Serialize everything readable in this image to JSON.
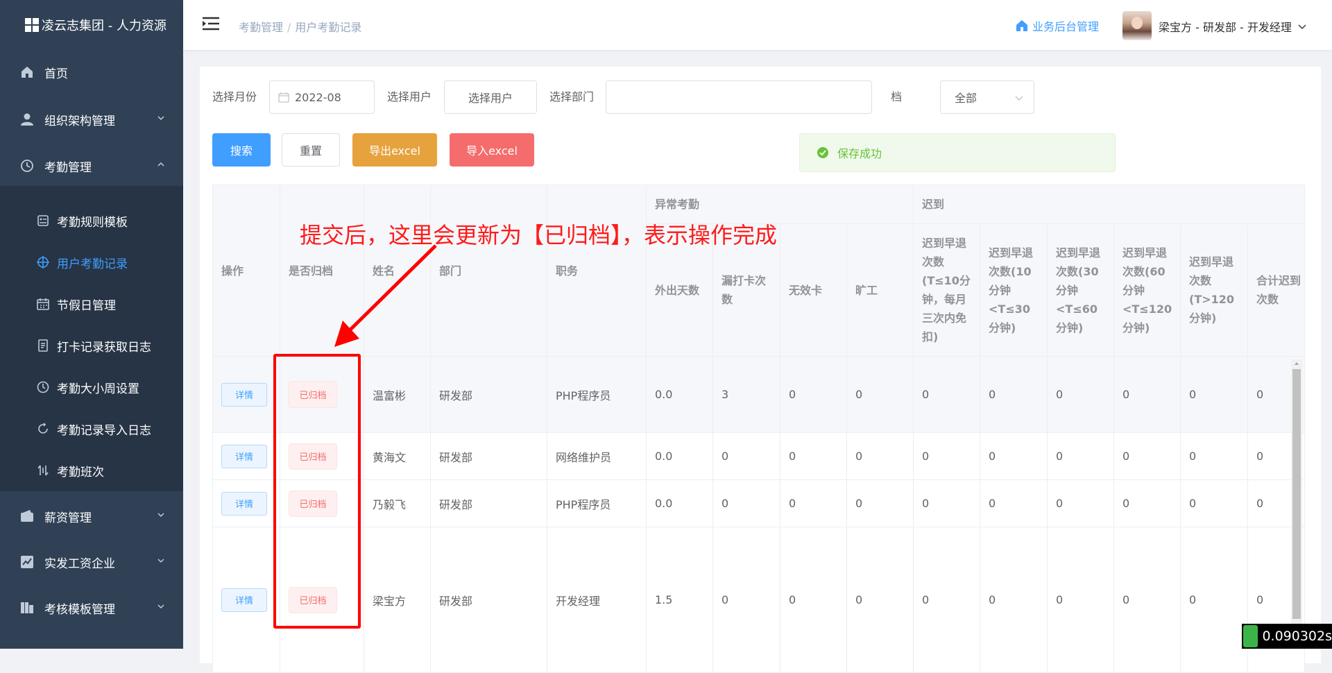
{
  "sidebar": {
    "brand": "凌云志集团 - 人力资源",
    "menu": [
      {
        "label": "首页",
        "icon": "home-icon"
      },
      {
        "label": "组织架构管理",
        "icon": "user-icon"
      },
      {
        "label": "考勤管理",
        "icon": "clock-icon"
      },
      {
        "label": "薪资管理",
        "icon": "wallet-icon"
      },
      {
        "label": "实发工资企业",
        "icon": "chart-icon"
      },
      {
        "label": "考核模板管理",
        "icon": "template-icon"
      }
    ],
    "attendance_sub": [
      {
        "label": "考勤规则模板",
        "icon": "rules-icon"
      },
      {
        "label": "用户考勤记录",
        "icon": "target-icon"
      },
      {
        "label": "节假日管理",
        "icon": "calendar-icon"
      },
      {
        "label": "打卡记录获取日志",
        "icon": "document-icon"
      },
      {
        "label": "考勤大小周设置",
        "icon": "clock-icon"
      },
      {
        "label": "考勤记录导入日志",
        "icon": "refresh-icon"
      },
      {
        "label": "考勤班次",
        "icon": "shift-icon"
      }
    ]
  },
  "navbar": {
    "breadcrumb": [
      "考勤管理",
      "用户考勤记录"
    ],
    "separator": "/",
    "backend_link": "业务后台管理",
    "user": "梁宝方 - 研发部 - 开发经理"
  },
  "filters": {
    "month_label": "选择月份",
    "month_value": "2022-08",
    "user_label": "选择用户",
    "user_placeholder": "选择用户",
    "dept_label": "选择部门",
    "archive_label": "档",
    "archive_value": "全部"
  },
  "buttons": {
    "search": "搜索",
    "reset": "重置",
    "export": "导出excel",
    "import": "导入excel"
  },
  "toast": "保存成功",
  "table": {
    "headers": {
      "op": "操作",
      "archived": "是否归档",
      "name": "姓名",
      "dept": "部门",
      "position": "职务",
      "abnormal_group": "异常考勤",
      "late_group": "迟到",
      "out_days": "外出天数",
      "missed_punch": "漏打卡次数",
      "invalid_card": "无效卡",
      "absent": "旷工",
      "late_10": "迟到早退次数(T≤10分钟，每月三次内免扣)",
      "late_30": "迟到早退次数(10分钟<T≤30分钟)",
      "late_60": "迟到早退次数(30分钟<T≤60分钟)",
      "late_120": "迟到早退次数(60分钟<T≤120分钟)",
      "late_over": "迟到早退次数(T>120分钟)",
      "late_total": "合计迟到次数"
    },
    "detail_label": "详情",
    "rows": [
      {
        "archived": "已归档",
        "name": "温富彬",
        "dept": "研发部",
        "position": "PHP程序员",
        "out_days": "0.0",
        "missed_punch": "3",
        "invalid_card": "0",
        "absent": "0",
        "late_10": "0",
        "late_30": "0",
        "late_60": "0",
        "late_120": "0",
        "late_over": "0",
        "late_total": "0"
      },
      {
        "archived": "已归档",
        "name": "黄海文",
        "dept": "研发部",
        "position": "网络维护员",
        "out_days": "0.0",
        "missed_punch": "0",
        "invalid_card": "0",
        "absent": "0",
        "late_10": "0",
        "late_30": "0",
        "late_60": "0",
        "late_120": "0",
        "late_over": "0",
        "late_total": "0"
      },
      {
        "archived": "已归档",
        "name": "乃毅飞",
        "dept": "研发部",
        "position": "PHP程序员",
        "out_days": "0.0",
        "missed_punch": "0",
        "invalid_card": "0",
        "absent": "0",
        "late_10": "0",
        "late_30": "0",
        "late_60": "0",
        "late_120": "0",
        "late_over": "0",
        "late_total": "0"
      },
      {
        "archived": "已归档",
        "name": "梁宝方",
        "dept": "研发部",
        "position": "开发经理",
        "out_days": "1.5",
        "missed_punch": "0",
        "invalid_card": "0",
        "absent": "0",
        "late_10": "0",
        "late_30": "0",
        "late_60": "0",
        "late_120": "0",
        "late_over": "0",
        "late_total": "0"
      }
    ]
  },
  "annotation": "提交后，这里会更新为【已归档】，表示操作完成",
  "timer": "0.090302s",
  "colors": {
    "sidebar_bg": "#304156",
    "primary": "#409eff",
    "annotation": "#ff0000"
  }
}
